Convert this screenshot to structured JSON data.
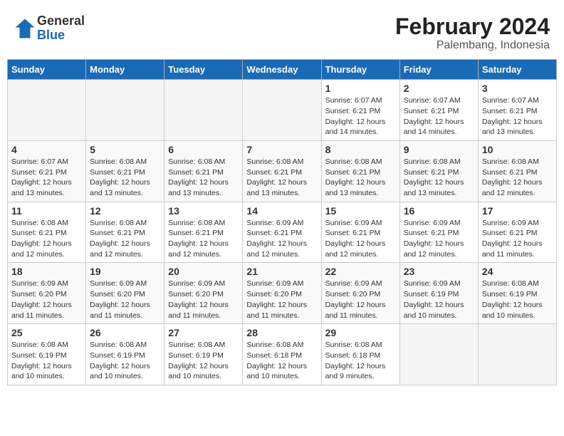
{
  "logo": {
    "general": "General",
    "blue": "Blue"
  },
  "title": "February 2024",
  "location": "Palembang, Indonesia",
  "days_header": [
    "Sunday",
    "Monday",
    "Tuesday",
    "Wednesday",
    "Thursday",
    "Friday",
    "Saturday"
  ],
  "weeks": [
    [
      {
        "day": "",
        "info": ""
      },
      {
        "day": "",
        "info": ""
      },
      {
        "day": "",
        "info": ""
      },
      {
        "day": "",
        "info": ""
      },
      {
        "day": "1",
        "info": "Sunrise: 6:07 AM\nSunset: 6:21 PM\nDaylight: 12 hours\nand 14 minutes."
      },
      {
        "day": "2",
        "info": "Sunrise: 6:07 AM\nSunset: 6:21 PM\nDaylight: 12 hours\nand 14 minutes."
      },
      {
        "day": "3",
        "info": "Sunrise: 6:07 AM\nSunset: 6:21 PM\nDaylight: 12 hours\nand 13 minutes."
      }
    ],
    [
      {
        "day": "4",
        "info": "Sunrise: 6:07 AM\nSunset: 6:21 PM\nDaylight: 12 hours\nand 13 minutes."
      },
      {
        "day": "5",
        "info": "Sunrise: 6:08 AM\nSunset: 6:21 PM\nDaylight: 12 hours\nand 13 minutes."
      },
      {
        "day": "6",
        "info": "Sunrise: 6:08 AM\nSunset: 6:21 PM\nDaylight: 12 hours\nand 13 minutes."
      },
      {
        "day": "7",
        "info": "Sunrise: 6:08 AM\nSunset: 6:21 PM\nDaylight: 12 hours\nand 13 minutes."
      },
      {
        "day": "8",
        "info": "Sunrise: 6:08 AM\nSunset: 6:21 PM\nDaylight: 12 hours\nand 13 minutes."
      },
      {
        "day": "9",
        "info": "Sunrise: 6:08 AM\nSunset: 6:21 PM\nDaylight: 12 hours\nand 13 minutes."
      },
      {
        "day": "10",
        "info": "Sunrise: 6:08 AM\nSunset: 6:21 PM\nDaylight: 12 hours\nand 12 minutes."
      }
    ],
    [
      {
        "day": "11",
        "info": "Sunrise: 6:08 AM\nSunset: 6:21 PM\nDaylight: 12 hours\nand 12 minutes."
      },
      {
        "day": "12",
        "info": "Sunrise: 6:08 AM\nSunset: 6:21 PM\nDaylight: 12 hours\nand 12 minutes."
      },
      {
        "day": "13",
        "info": "Sunrise: 6:08 AM\nSunset: 6:21 PM\nDaylight: 12 hours\nand 12 minutes."
      },
      {
        "day": "14",
        "info": "Sunrise: 6:09 AM\nSunset: 6:21 PM\nDaylight: 12 hours\nand 12 minutes."
      },
      {
        "day": "15",
        "info": "Sunrise: 6:09 AM\nSunset: 6:21 PM\nDaylight: 12 hours\nand 12 minutes."
      },
      {
        "day": "16",
        "info": "Sunrise: 6:09 AM\nSunset: 6:21 PM\nDaylight: 12 hours\nand 12 minutes."
      },
      {
        "day": "17",
        "info": "Sunrise: 6:09 AM\nSunset: 6:21 PM\nDaylight: 12 hours\nand 11 minutes."
      }
    ],
    [
      {
        "day": "18",
        "info": "Sunrise: 6:09 AM\nSunset: 6:20 PM\nDaylight: 12 hours\nand 11 minutes."
      },
      {
        "day": "19",
        "info": "Sunrise: 6:09 AM\nSunset: 6:20 PM\nDaylight: 12 hours\nand 11 minutes."
      },
      {
        "day": "20",
        "info": "Sunrise: 6:09 AM\nSunset: 6:20 PM\nDaylight: 12 hours\nand 11 minutes."
      },
      {
        "day": "21",
        "info": "Sunrise: 6:09 AM\nSunset: 6:20 PM\nDaylight: 12 hours\nand 11 minutes."
      },
      {
        "day": "22",
        "info": "Sunrise: 6:09 AM\nSunset: 6:20 PM\nDaylight: 12 hours\nand 11 minutes."
      },
      {
        "day": "23",
        "info": "Sunrise: 6:09 AM\nSunset: 6:19 PM\nDaylight: 12 hours\nand 10 minutes."
      },
      {
        "day": "24",
        "info": "Sunrise: 6:08 AM\nSunset: 6:19 PM\nDaylight: 12 hours\nand 10 minutes."
      }
    ],
    [
      {
        "day": "25",
        "info": "Sunrise: 6:08 AM\nSunset: 6:19 PM\nDaylight: 12 hours\nand 10 minutes."
      },
      {
        "day": "26",
        "info": "Sunrise: 6:08 AM\nSunset: 6:19 PM\nDaylight: 12 hours\nand 10 minutes."
      },
      {
        "day": "27",
        "info": "Sunrise: 6:08 AM\nSunset: 6:19 PM\nDaylight: 12 hours\nand 10 minutes."
      },
      {
        "day": "28",
        "info": "Sunrise: 6:08 AM\nSunset: 6:18 PM\nDaylight: 12 hours\nand 10 minutes."
      },
      {
        "day": "29",
        "info": "Sunrise: 6:08 AM\nSunset: 6:18 PM\nDaylight: 12 hours\nand 9 minutes."
      },
      {
        "day": "",
        "info": ""
      },
      {
        "day": "",
        "info": ""
      }
    ]
  ]
}
